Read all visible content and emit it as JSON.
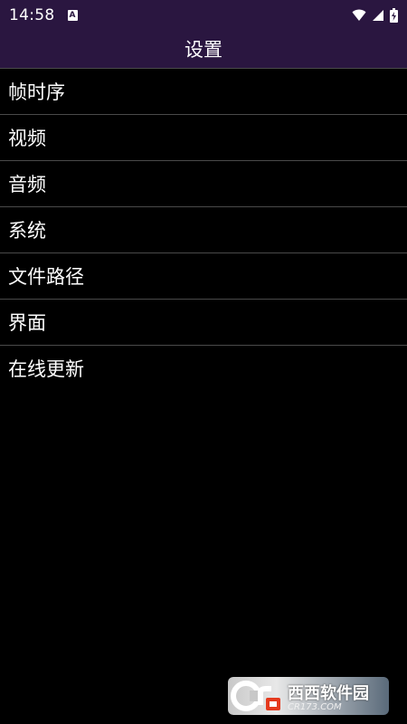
{
  "status_bar": {
    "time": "14:58",
    "notification_letter": "A",
    "icons": [
      "wifi-icon",
      "signal-icon",
      "battery-icon"
    ]
  },
  "app_bar": {
    "title": "设置"
  },
  "menu": {
    "items": [
      {
        "label": "帧时序"
      },
      {
        "label": "视频"
      },
      {
        "label": "音频"
      },
      {
        "label": "系统"
      },
      {
        "label": "文件路径"
      },
      {
        "label": "界面"
      },
      {
        "label": "在线更新"
      }
    ]
  },
  "watermark": {
    "logo_text": "Cr",
    "name": "西西软件园",
    "url": "CR173.COM"
  },
  "colors": {
    "bar_bg": "#2a1640",
    "background": "#000000",
    "divider": "#4a4a4a",
    "text": "#ffffff"
  }
}
